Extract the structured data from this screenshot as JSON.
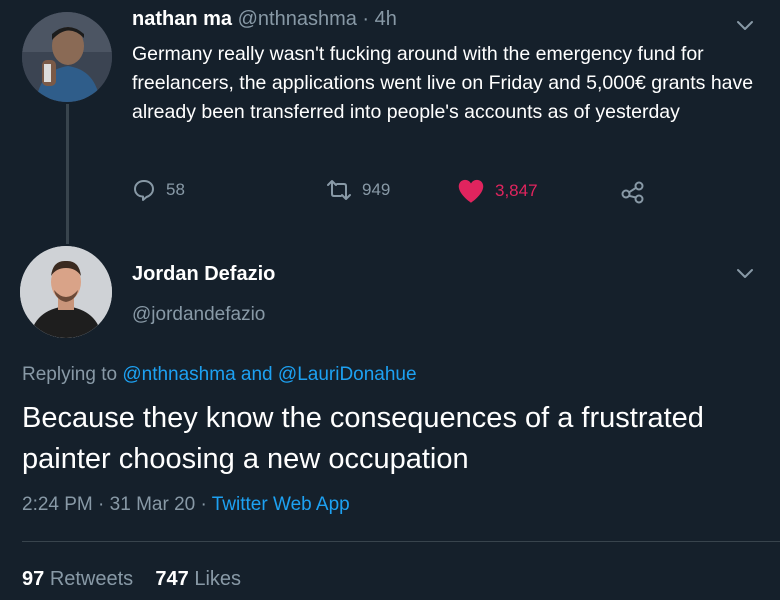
{
  "tweet1": {
    "display_name": "nathan ma",
    "handle": "@nthnashma",
    "separator": "·",
    "time_ago": "4h",
    "text": "Germany really wasn't fucking around with the emergency fund for freelancers, the applications went live on Friday and 5,000€ grants have already been transferred into people's accounts as of yesterday",
    "replies": "58",
    "retweets": "949",
    "likes": "3,847",
    "icons": {
      "reply": "reply-icon",
      "retweet": "retweet-icon",
      "like": "heart-icon",
      "share": "share-icon",
      "menu": "chevron-down-icon"
    }
  },
  "tweet2": {
    "display_name": "Jordan Defazio",
    "handle": "@jordandefazio",
    "replying_prefix": "Replying to",
    "reply_user1": "@nthnashma",
    "reply_and": "and",
    "reply_user2": "@LauriDonahue",
    "text": "Because they know the consequences of a frustrated painter choosing a new occupation",
    "time": "2:24 PM",
    "date": "31 Mar 20",
    "source": "Twitter Web App",
    "meta_separator": "·",
    "retweet_count": "97",
    "retweet_label": "Retweets",
    "like_count": "747",
    "like_label": "Likes"
  },
  "colors": {
    "background": "#15202b",
    "text": "#ffffff",
    "muted": "#8899a6",
    "link": "#1da1f2",
    "like": "#e0245e",
    "divider": "#38444d"
  }
}
